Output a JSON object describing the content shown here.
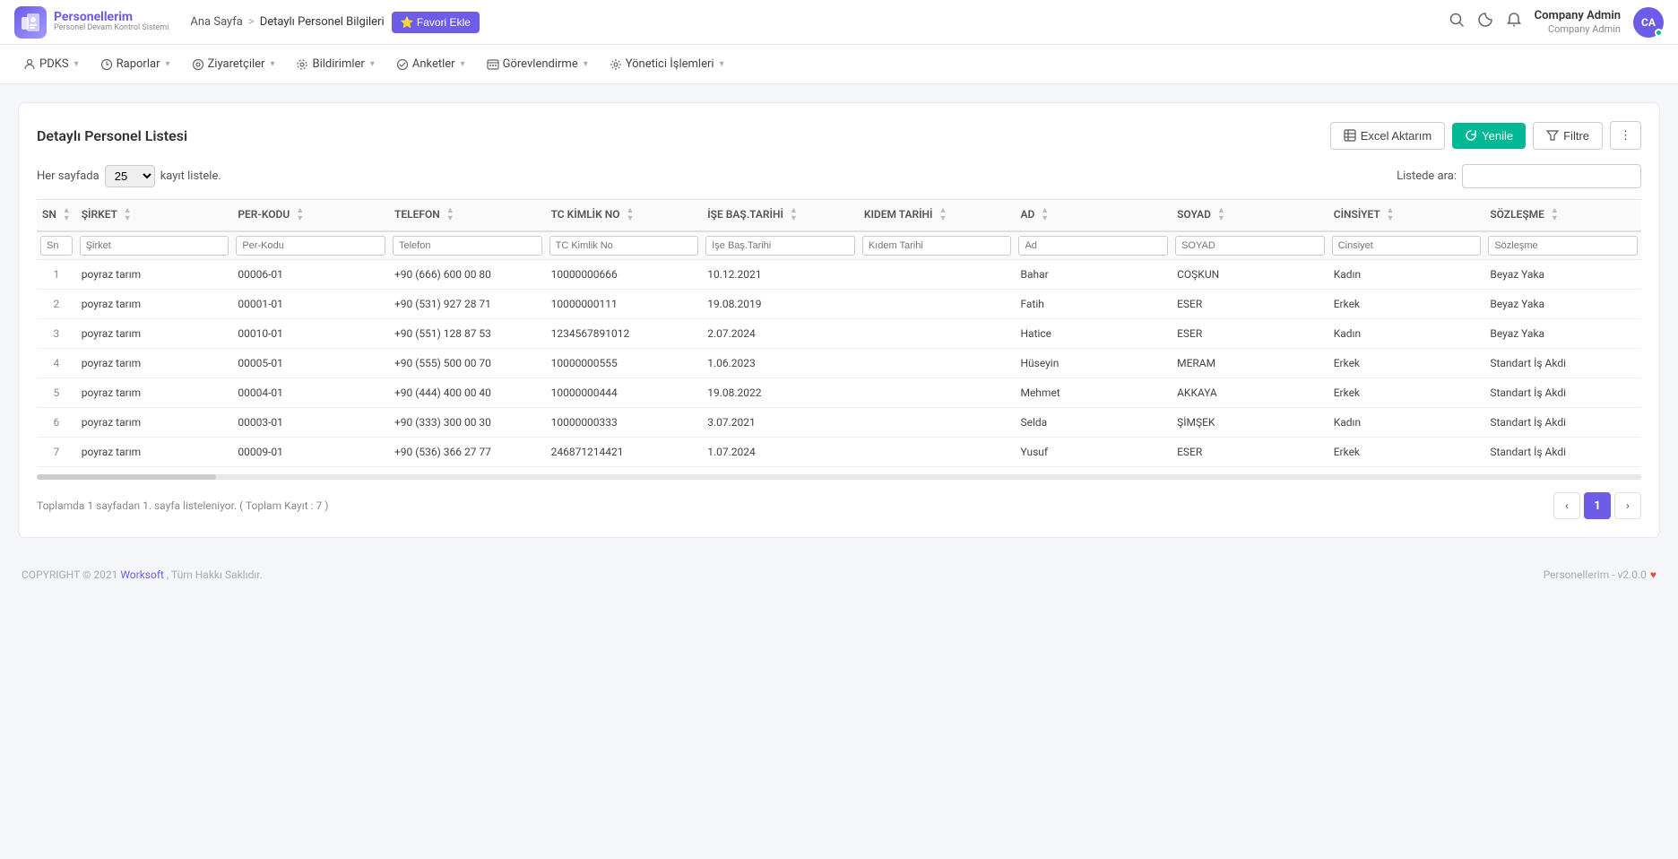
{
  "header": {
    "logo": {
      "brand": "Personellerim",
      "sub": "Personel Devam Kontrol Sistemi",
      "icon": "⚙"
    },
    "breadcrumb": {
      "home": "Ana Sayfa",
      "separator": ">",
      "current": "Detaylı Personel Bilgileri"
    },
    "fav_button": "⭐ Favori Ekle",
    "user": {
      "name": "Company Admin",
      "role": "Company Admin",
      "initials": "CA"
    }
  },
  "nav": {
    "items": [
      {
        "id": "pdks",
        "label": "PDKS",
        "icon": "person"
      },
      {
        "id": "raporlar",
        "label": "Raporlar",
        "icon": "clock"
      },
      {
        "id": "ziyaretciler",
        "label": "Ziyaretçiler",
        "icon": "eye"
      },
      {
        "id": "bildirimler",
        "label": "Bildirimler",
        "icon": "radio"
      },
      {
        "id": "anketler",
        "label": "Anketler",
        "icon": "check"
      },
      {
        "id": "gorevlendirme",
        "label": "Görevlendirme",
        "icon": "monitor"
      },
      {
        "id": "yonetici",
        "label": "Yönetici İşlemleri",
        "icon": "gear"
      }
    ]
  },
  "page": {
    "title": "Detaylı Personel Listesi",
    "buttons": {
      "excel": "Excel Aktarım",
      "yenile": "Yenile",
      "filtre": "Filtre",
      "more": "⋮"
    },
    "per_page_label": "Her sayfada",
    "per_page_value": "25",
    "per_page_suffix": "kayıt listele.",
    "search_label": "Listede ara:",
    "search_placeholder": "",
    "columns": [
      {
        "key": "sn",
        "label": "SN",
        "filter_placeholder": "Sn"
      },
      {
        "key": "sirket",
        "label": "ŞİRKET",
        "filter_placeholder": "Şirket"
      },
      {
        "key": "per_kodu",
        "label": "PER-KODU",
        "filter_placeholder": "Per-Kodu"
      },
      {
        "key": "telefon",
        "label": "TELEFON",
        "filter_placeholder": "Telefon"
      },
      {
        "key": "tc_no",
        "label": "TC KİMLİK NO",
        "filter_placeholder": "TC Kimlik No"
      },
      {
        "key": "ise_bas",
        "label": "İŞE BAŞ.TARİHİ",
        "filter_placeholder": "İşe Baş.Tarihi"
      },
      {
        "key": "kidem",
        "label": "KIDEM TARİHİ",
        "filter_placeholder": "Kıdem Tarihi"
      },
      {
        "key": "ad",
        "label": "AD",
        "filter_placeholder": "Ad"
      },
      {
        "key": "soyad",
        "label": "SOYAD",
        "filter_placeholder": "SOYAD"
      },
      {
        "key": "cinsiyet",
        "label": "CİNSİYET",
        "filter_placeholder": "Cinsiyet"
      },
      {
        "key": "sozlesme",
        "label": "SÖZLEŞME",
        "filter_placeholder": "Sözleşme"
      }
    ],
    "rows": [
      {
        "sn": 1,
        "sirket": "poyraz tarım",
        "per_kodu": "00006-01",
        "telefon": "+90 (666) 600 00 80",
        "tc_no": "10000000666",
        "ise_bas": "10.12.2021",
        "kidem": "",
        "ad": "Bahar",
        "soyad": "COŞKUN",
        "cinsiyet": "Kadın",
        "sozlesme": "Beyaz Yaka"
      },
      {
        "sn": 2,
        "sirket": "poyraz tarım",
        "per_kodu": "00001-01",
        "telefon": "+90 (531) 927 28 71",
        "tc_no": "10000000111",
        "ise_bas": "19.08.2019",
        "kidem": "",
        "ad": "Fatih",
        "soyad": "ESER",
        "cinsiyet": "Erkek",
        "sozlesme": "Beyaz Yaka"
      },
      {
        "sn": 3,
        "sirket": "poyraz tarım",
        "per_kodu": "00010-01",
        "telefon": "+90 (551) 128 87 53",
        "tc_no": "1234567891012",
        "ise_bas": "2.07.2024",
        "kidem": "",
        "ad": "Hatice",
        "soyad": "ESER",
        "cinsiyet": "Kadın",
        "sozlesme": "Beyaz Yaka"
      },
      {
        "sn": 4,
        "sirket": "poyraz tarım",
        "per_kodu": "00005-01",
        "telefon": "+90 (555) 500 00 70",
        "tc_no": "10000000555",
        "ise_bas": "1.06.2023",
        "kidem": "",
        "ad": "Hüseyin",
        "soyad": "MERAM",
        "cinsiyet": "Erkek",
        "sozlesme": "Standart İş Akdi"
      },
      {
        "sn": 5,
        "sirket": "poyraz tarım",
        "per_kodu": "00004-01",
        "telefon": "+90 (444) 400 00 40",
        "tc_no": "10000000444",
        "ise_bas": "19.08.2022",
        "kidem": "",
        "ad": "Mehmet",
        "soyad": "AKKAYA",
        "cinsiyet": "Erkek",
        "sozlesme": "Standart İş Akdi"
      },
      {
        "sn": 6,
        "sirket": "poyraz tarım",
        "per_kodu": "00003-01",
        "telefon": "+90 (333) 300 00 30",
        "tc_no": "10000000333",
        "ise_bas": "3.07.2021",
        "kidem": "",
        "ad": "Selda",
        "soyad": "ŞİMŞEK",
        "cinsiyet": "Kadın",
        "sozlesme": "Standart İş Akdi"
      },
      {
        "sn": 7,
        "sirket": "poyraz tarım",
        "per_kodu": "00009-01",
        "telefon": "+90 (536) 366 27 77",
        "tc_no": "246871214421",
        "ise_bas": "1.07.2024",
        "kidem": "",
        "ad": "Yusuf",
        "soyad": "ESER",
        "cinsiyet": "Erkek",
        "sozlesme": "Standart İş Akdi"
      }
    ],
    "pagination": {
      "info": "Toplamda 1 sayfadan 1. sayfa listeleniyor. ( Toplam Kayıt : 7 )",
      "current_page": 1,
      "total_pages": 1
    }
  },
  "footer": {
    "copyright": "COPYRIGHT © 2021",
    "company": "Worksoft",
    "suffix": ", Tüm Hakkı Saklıdır.",
    "version": "Personellerim - v2.0.0"
  }
}
